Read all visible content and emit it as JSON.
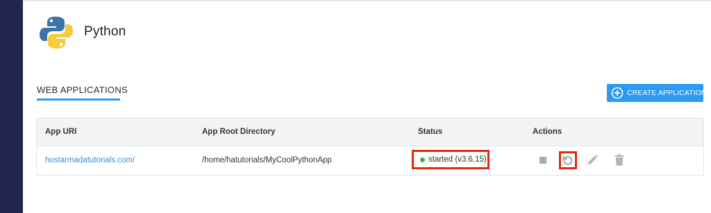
{
  "header": {
    "title": "Python"
  },
  "section": {
    "title": "WEB APPLICATIONS"
  },
  "actions": {
    "create_label": "CREATE APPLICATION"
  },
  "table": {
    "columns": [
      "App URI",
      "App Root Directory",
      "Status",
      "Actions"
    ],
    "rows": [
      {
        "app_uri": "hostarmadatutorials.com/",
        "root_dir": "/home/hatutorials/MyCoolPythonApp",
        "status": "started (v3.6.15)"
      }
    ]
  },
  "colors": {
    "accent": "#2b9af3",
    "highlight": "#e8260e",
    "status_ok": "#3bb54a",
    "sidebar": "#20264f"
  },
  "icons": [
    "python-logo-icon",
    "plus-circle-icon",
    "stop-icon",
    "restart-icon",
    "edit-pencil-icon",
    "trash-icon"
  ]
}
